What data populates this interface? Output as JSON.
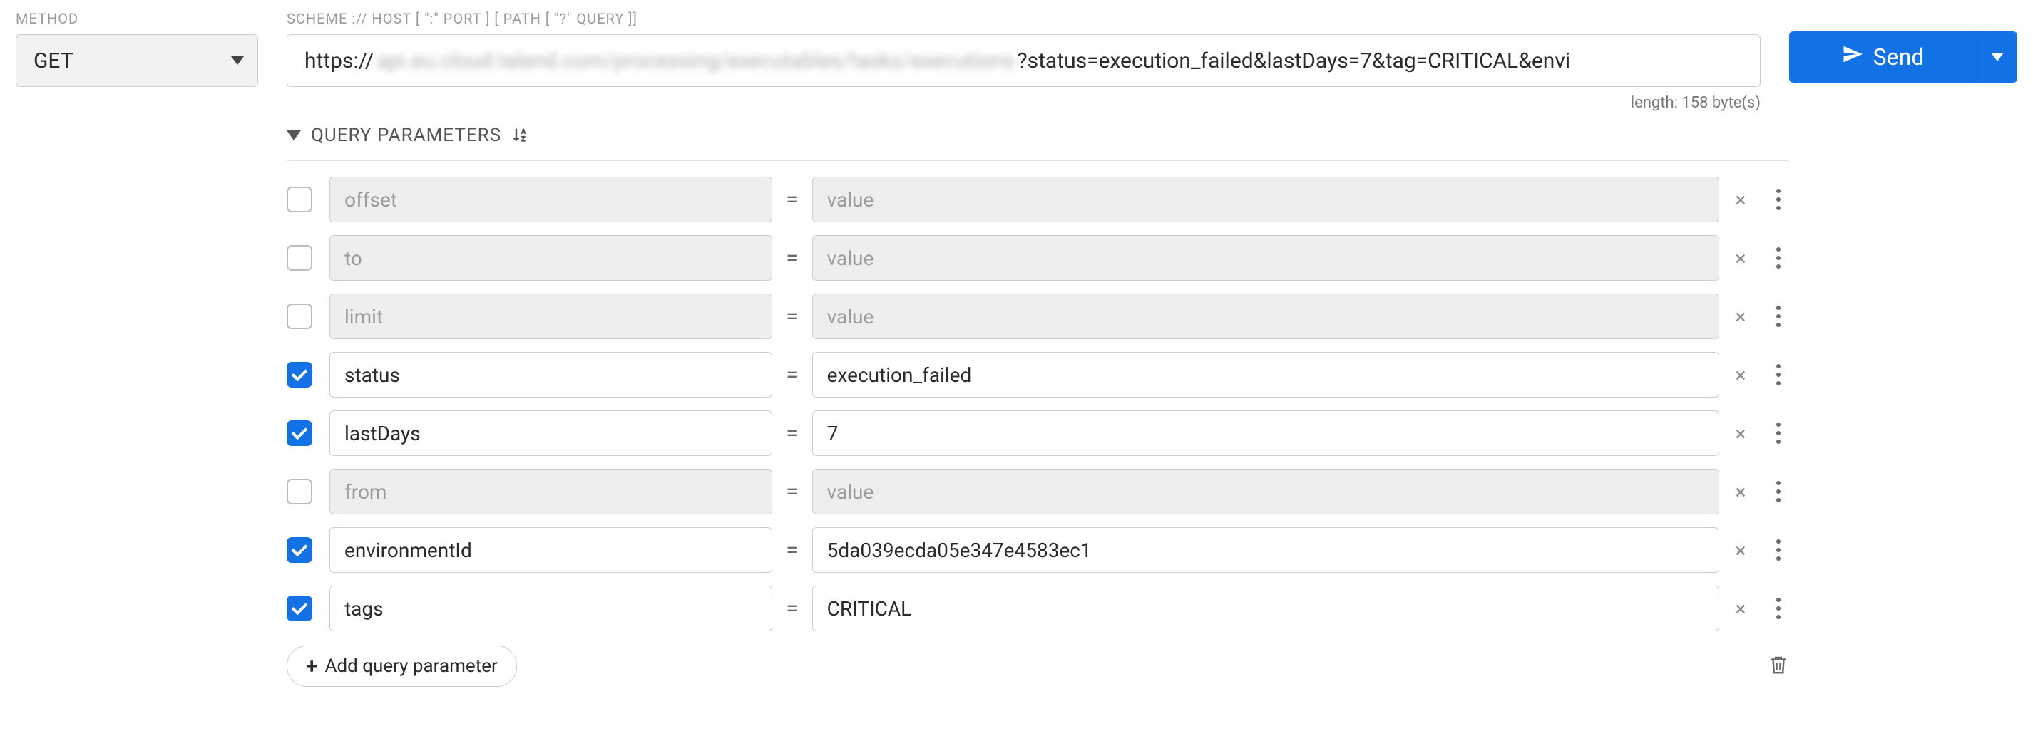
{
  "labels": {
    "method": "METHOD",
    "scheme": "SCHEME :// HOST [ \":\" PORT ] [ PATH [ \"?\" QUERY ]]",
    "length": "length: 158 byte(s)",
    "query_parameters": "QUERY PARAMETERS",
    "add_query": "Add query parameter"
  },
  "method": {
    "value": "GET"
  },
  "url": {
    "prefix": "https://",
    "blurred": "api.eu.cloud.talend.com/processing/executables/tasks/executions",
    "suffix": "?status=execution_failed&lastDays=7&tag=CRITICAL&envi"
  },
  "send": {
    "label": "Send"
  },
  "value_placeholder": "value",
  "params": [
    {
      "enabled": false,
      "name": "offset",
      "value": ""
    },
    {
      "enabled": false,
      "name": "to",
      "value": ""
    },
    {
      "enabled": false,
      "name": "limit",
      "value": ""
    },
    {
      "enabled": true,
      "name": "status",
      "value": "execution_failed"
    },
    {
      "enabled": true,
      "name": "lastDays",
      "value": "7"
    },
    {
      "enabled": false,
      "name": "from",
      "value": ""
    },
    {
      "enabled": true,
      "name": "environmentId",
      "value": "5da039ecda05e347e4583ec1"
    },
    {
      "enabled": true,
      "name": "tags",
      "value": "CRITICAL"
    }
  ]
}
